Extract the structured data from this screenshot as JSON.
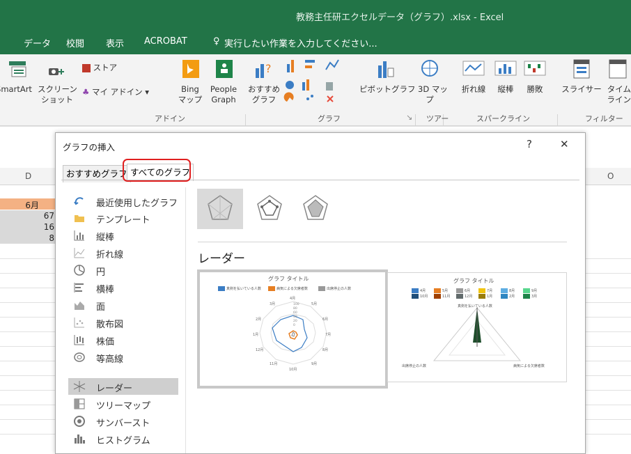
{
  "window_title": "教務主任研エクセルデータ（グラフ）.xlsx - Excel",
  "menu": [
    "データ",
    "校閲",
    "表示",
    "ACROBAT"
  ],
  "tell_me": "実行したい作業を入力してください...",
  "ribbon": {
    "smartart": "SmartArt",
    "screenshot": "スクリーン\nショット",
    "store": "ストア",
    "myaddins": "マイ アドイン",
    "bing": "Bing\nマップ",
    "people": "People\nGraph",
    "recommended": "おすすめ\nグラフ",
    "pivot": "ピボットグラフ",
    "map3d": "3D マッ\nプ",
    "line": "折れ線",
    "column": "縦棒",
    "winloss": "勝敗",
    "slicer": "スライサー",
    "timeline": "タイム\nライン",
    "groups": {
      "addins": "アドイン",
      "charts": "グラフ",
      "tours": "ツアー",
      "sparklines": "スパークライン",
      "filters": "フィルター"
    }
  },
  "sheet": {
    "col_d": "D",
    "col_o": "O",
    "cells": [
      "6月",
      "67",
      "16",
      "8"
    ]
  },
  "dialog": {
    "title": "グラフの挿入",
    "help": "?",
    "close": "✕",
    "tabs": [
      "おすすめグラフ",
      "すべてのグラフ"
    ],
    "categories": [
      {
        "label": "最近使用したグラフ",
        "icon": "recent-chart-icon"
      },
      {
        "label": "テンプレート",
        "icon": "template-folder-icon"
      },
      {
        "label": "縦棒",
        "icon": "column-chart-icon"
      },
      {
        "label": "折れ線",
        "icon": "line-chart-icon"
      },
      {
        "label": "円",
        "icon": "pie-chart-icon"
      },
      {
        "label": "横棒",
        "icon": "bar-chart-icon"
      },
      {
        "label": "面",
        "icon": "area-chart-icon"
      },
      {
        "label": "散布図",
        "icon": "scatter-chart-icon"
      },
      {
        "label": "株価",
        "icon": "stock-chart-icon"
      },
      {
        "label": "等高線",
        "icon": "surface-chart-icon"
      },
      {
        "label": "レーダー",
        "icon": "radar-chart-icon"
      },
      {
        "label": "ツリーマップ",
        "icon": "treemap-chart-icon"
      },
      {
        "label": "サンバースト",
        "icon": "sunburst-chart-icon"
      },
      {
        "label": "ヒストグラム",
        "icon": "histogram-chart-icon"
      }
    ],
    "selected_category": "レーダー",
    "heading": "レーダー",
    "preview1": {
      "title": "グラフ タイトル",
      "legend": [
        "真剣を払いている人数",
        "病気による欠席者数",
        "出席停止の人数"
      ],
      "months": [
        "4月",
        "5月",
        "6月",
        "7月",
        "8月",
        "9月",
        "10月",
        "11月",
        "12月",
        "1月",
        "2月",
        "3月"
      ],
      "ticks": [
        "100",
        "80",
        "60",
        "40",
        "20",
        "0"
      ]
    },
    "preview2": {
      "title": "グラフ タイトル",
      "legend_row1": [
        "4月",
        "5月",
        "6月",
        "7月",
        "8月",
        "9月"
      ],
      "legend_row2": [
        "10月",
        "11月",
        "12月",
        "1月",
        "2月",
        "3月"
      ],
      "axis_labels": [
        "真剣を払いている人数",
        "出席停止の人数",
        "病気による欠席者数"
      ]
    }
  }
}
